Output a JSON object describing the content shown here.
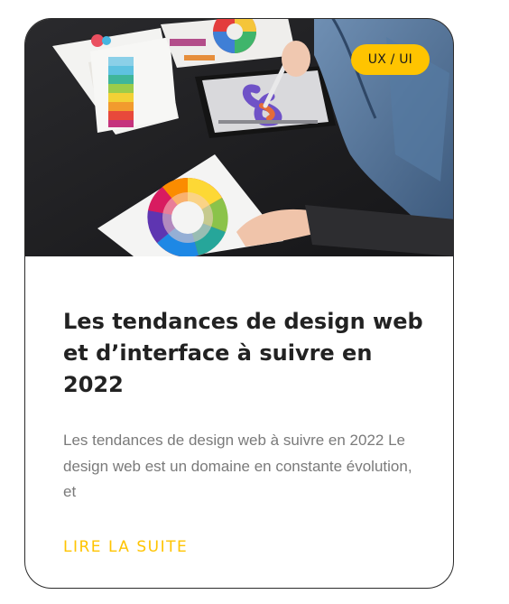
{
  "card": {
    "category_badge": "UX / UI",
    "title": "Les tendances de design web et d’interface à suivre en 2022",
    "excerpt": "Les tendances de design web à suivre en 2022 Le design web est un domaine en constante évolution, et",
    "read_more": "LIRE LA SUITE",
    "image_icon": "designer-color-wheel-photo"
  },
  "colors": {
    "accent": "#ffc400",
    "title": "#222222",
    "excerpt": "#7a7a7a",
    "border": "#2b2b2b"
  }
}
